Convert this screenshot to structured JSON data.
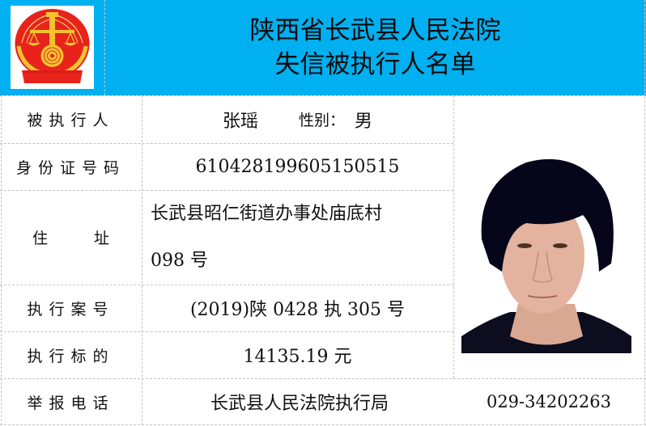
{
  "header": {
    "court_name": "陕西省长武县人民法院",
    "list_title": "失信被执行人名单",
    "logo": "court-emblem-icon",
    "background_color": "#00B0F0"
  },
  "rows": {
    "person": {
      "label": "被执行人",
      "name": "张瑶",
      "gender_label": "性别：",
      "gender": "男"
    },
    "id_number": {
      "label": "身份证号码",
      "value": "610428199605150515"
    },
    "address": {
      "label_left": "住",
      "label_right": "址",
      "line1": "长武县昭仁街道办事处庙底村",
      "line2": "098 号"
    },
    "case_number": {
      "label": "执行案号",
      "value": "(2019)陕 0428 执 305 号"
    },
    "amount": {
      "label": "执行标的",
      "value": "14135.19 元"
    },
    "report_phone": {
      "label": "举报电话",
      "office": "长武县人民法院执行局",
      "phone": "029-34202263"
    }
  },
  "photo": {
    "alt": "person-portrait-photo"
  }
}
